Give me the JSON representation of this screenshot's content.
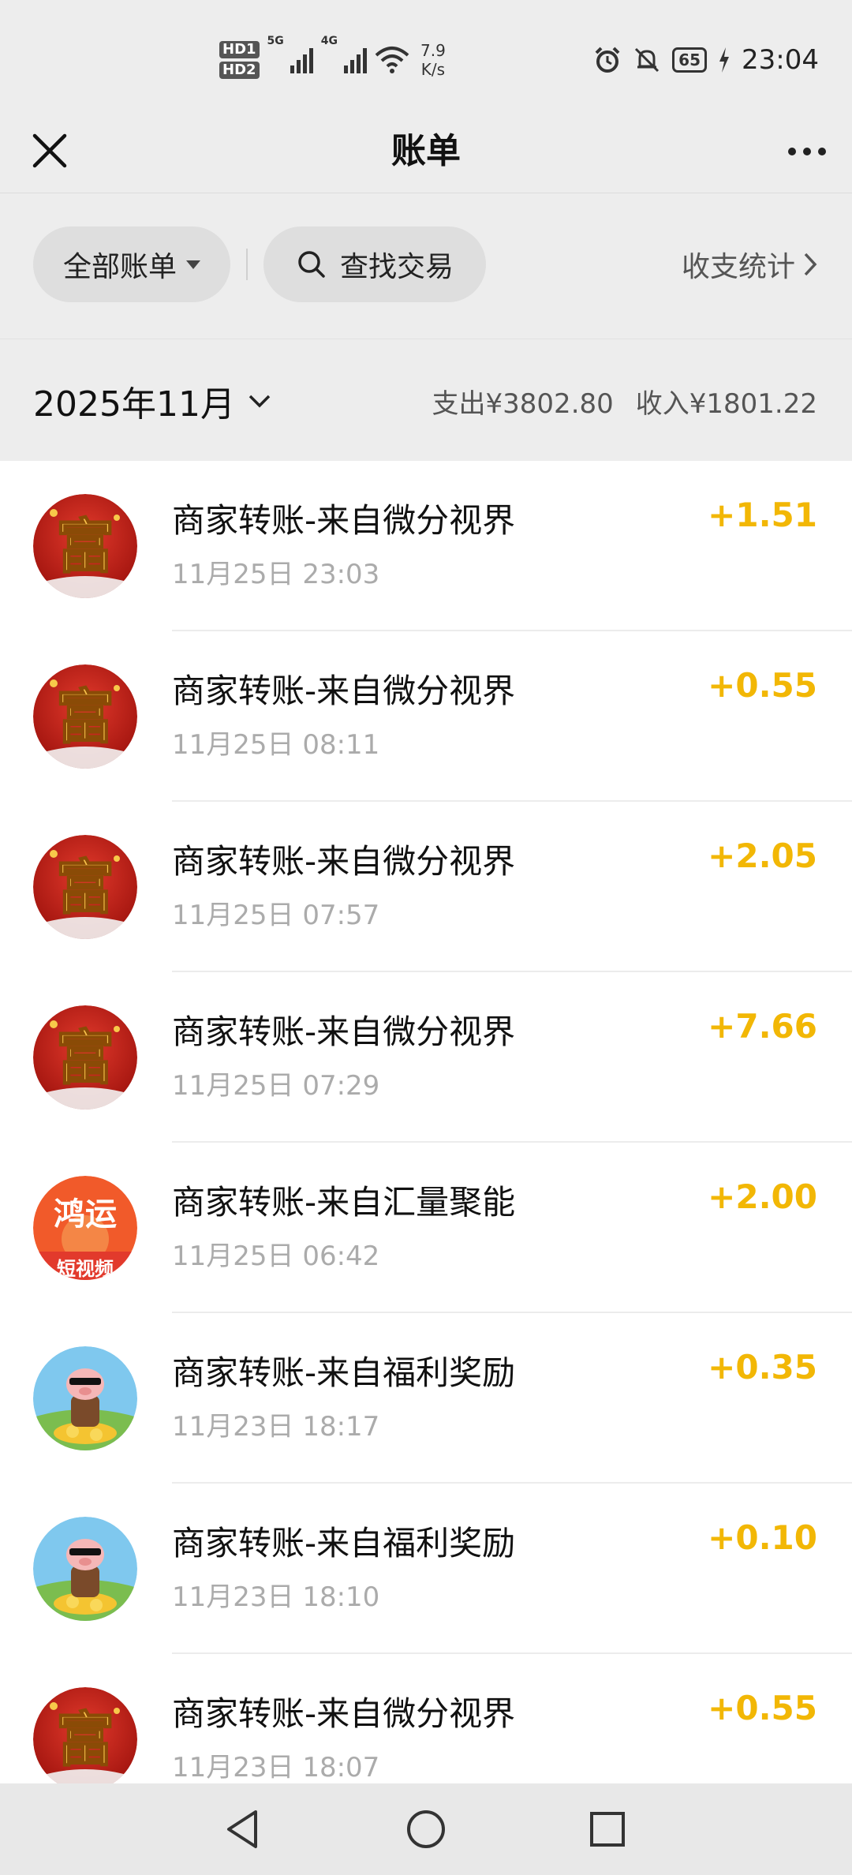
{
  "status_bar": {
    "hd1": "HD1",
    "hd2": "HD2",
    "net1": "5G",
    "net2": "4G",
    "speed_value": "7.9",
    "speed_unit": "K/s",
    "battery": "65",
    "time": "23:04"
  },
  "header": {
    "title": "账单"
  },
  "filters": {
    "all_label": "全部账单",
    "search_label": "查找交易",
    "stats_label": "收支统计"
  },
  "month": {
    "label": "2025年11月",
    "expense": "支出¥3802.80",
    "income": "收入¥1801.22"
  },
  "colors": {
    "amount": "#f2b705",
    "background": "#ededed"
  },
  "transactions": [
    {
      "name": "商家转账-来自微分视界",
      "time": "11月25日 23:03",
      "amount": "+1.51",
      "avatar": "fu-icon"
    },
    {
      "name": "商家转账-来自微分视界",
      "time": "11月25日 08:11",
      "amount": "+0.55",
      "avatar": "fu-icon"
    },
    {
      "name": "商家转账-来自微分视界",
      "time": "11月25日 07:57",
      "amount": "+2.05",
      "avatar": "fu-icon"
    },
    {
      "name": "商家转账-来自微分视界",
      "time": "11月25日 07:29",
      "amount": "+7.66",
      "avatar": "fu-icon"
    },
    {
      "name": "商家转账-来自汇量聚能",
      "time": "11月25日 06:42",
      "amount": "+2.00",
      "avatar": "hongyun-icon",
      "avatar_text": "鸿运",
      "avatar_subtext": "短视频"
    },
    {
      "name": "商家转账-来自福利奖励",
      "time": "11月23日 18:17",
      "amount": "+0.35",
      "avatar": "pig-icon"
    },
    {
      "name": "商家转账-来自福利奖励",
      "time": "11月23日 18:10",
      "amount": "+0.10",
      "avatar": "pig-icon"
    },
    {
      "name": "商家转账-来自微分视界",
      "time": "11月23日 18:07",
      "amount": "+0.55",
      "avatar": "fu-icon"
    }
  ],
  "fu_char": "富"
}
